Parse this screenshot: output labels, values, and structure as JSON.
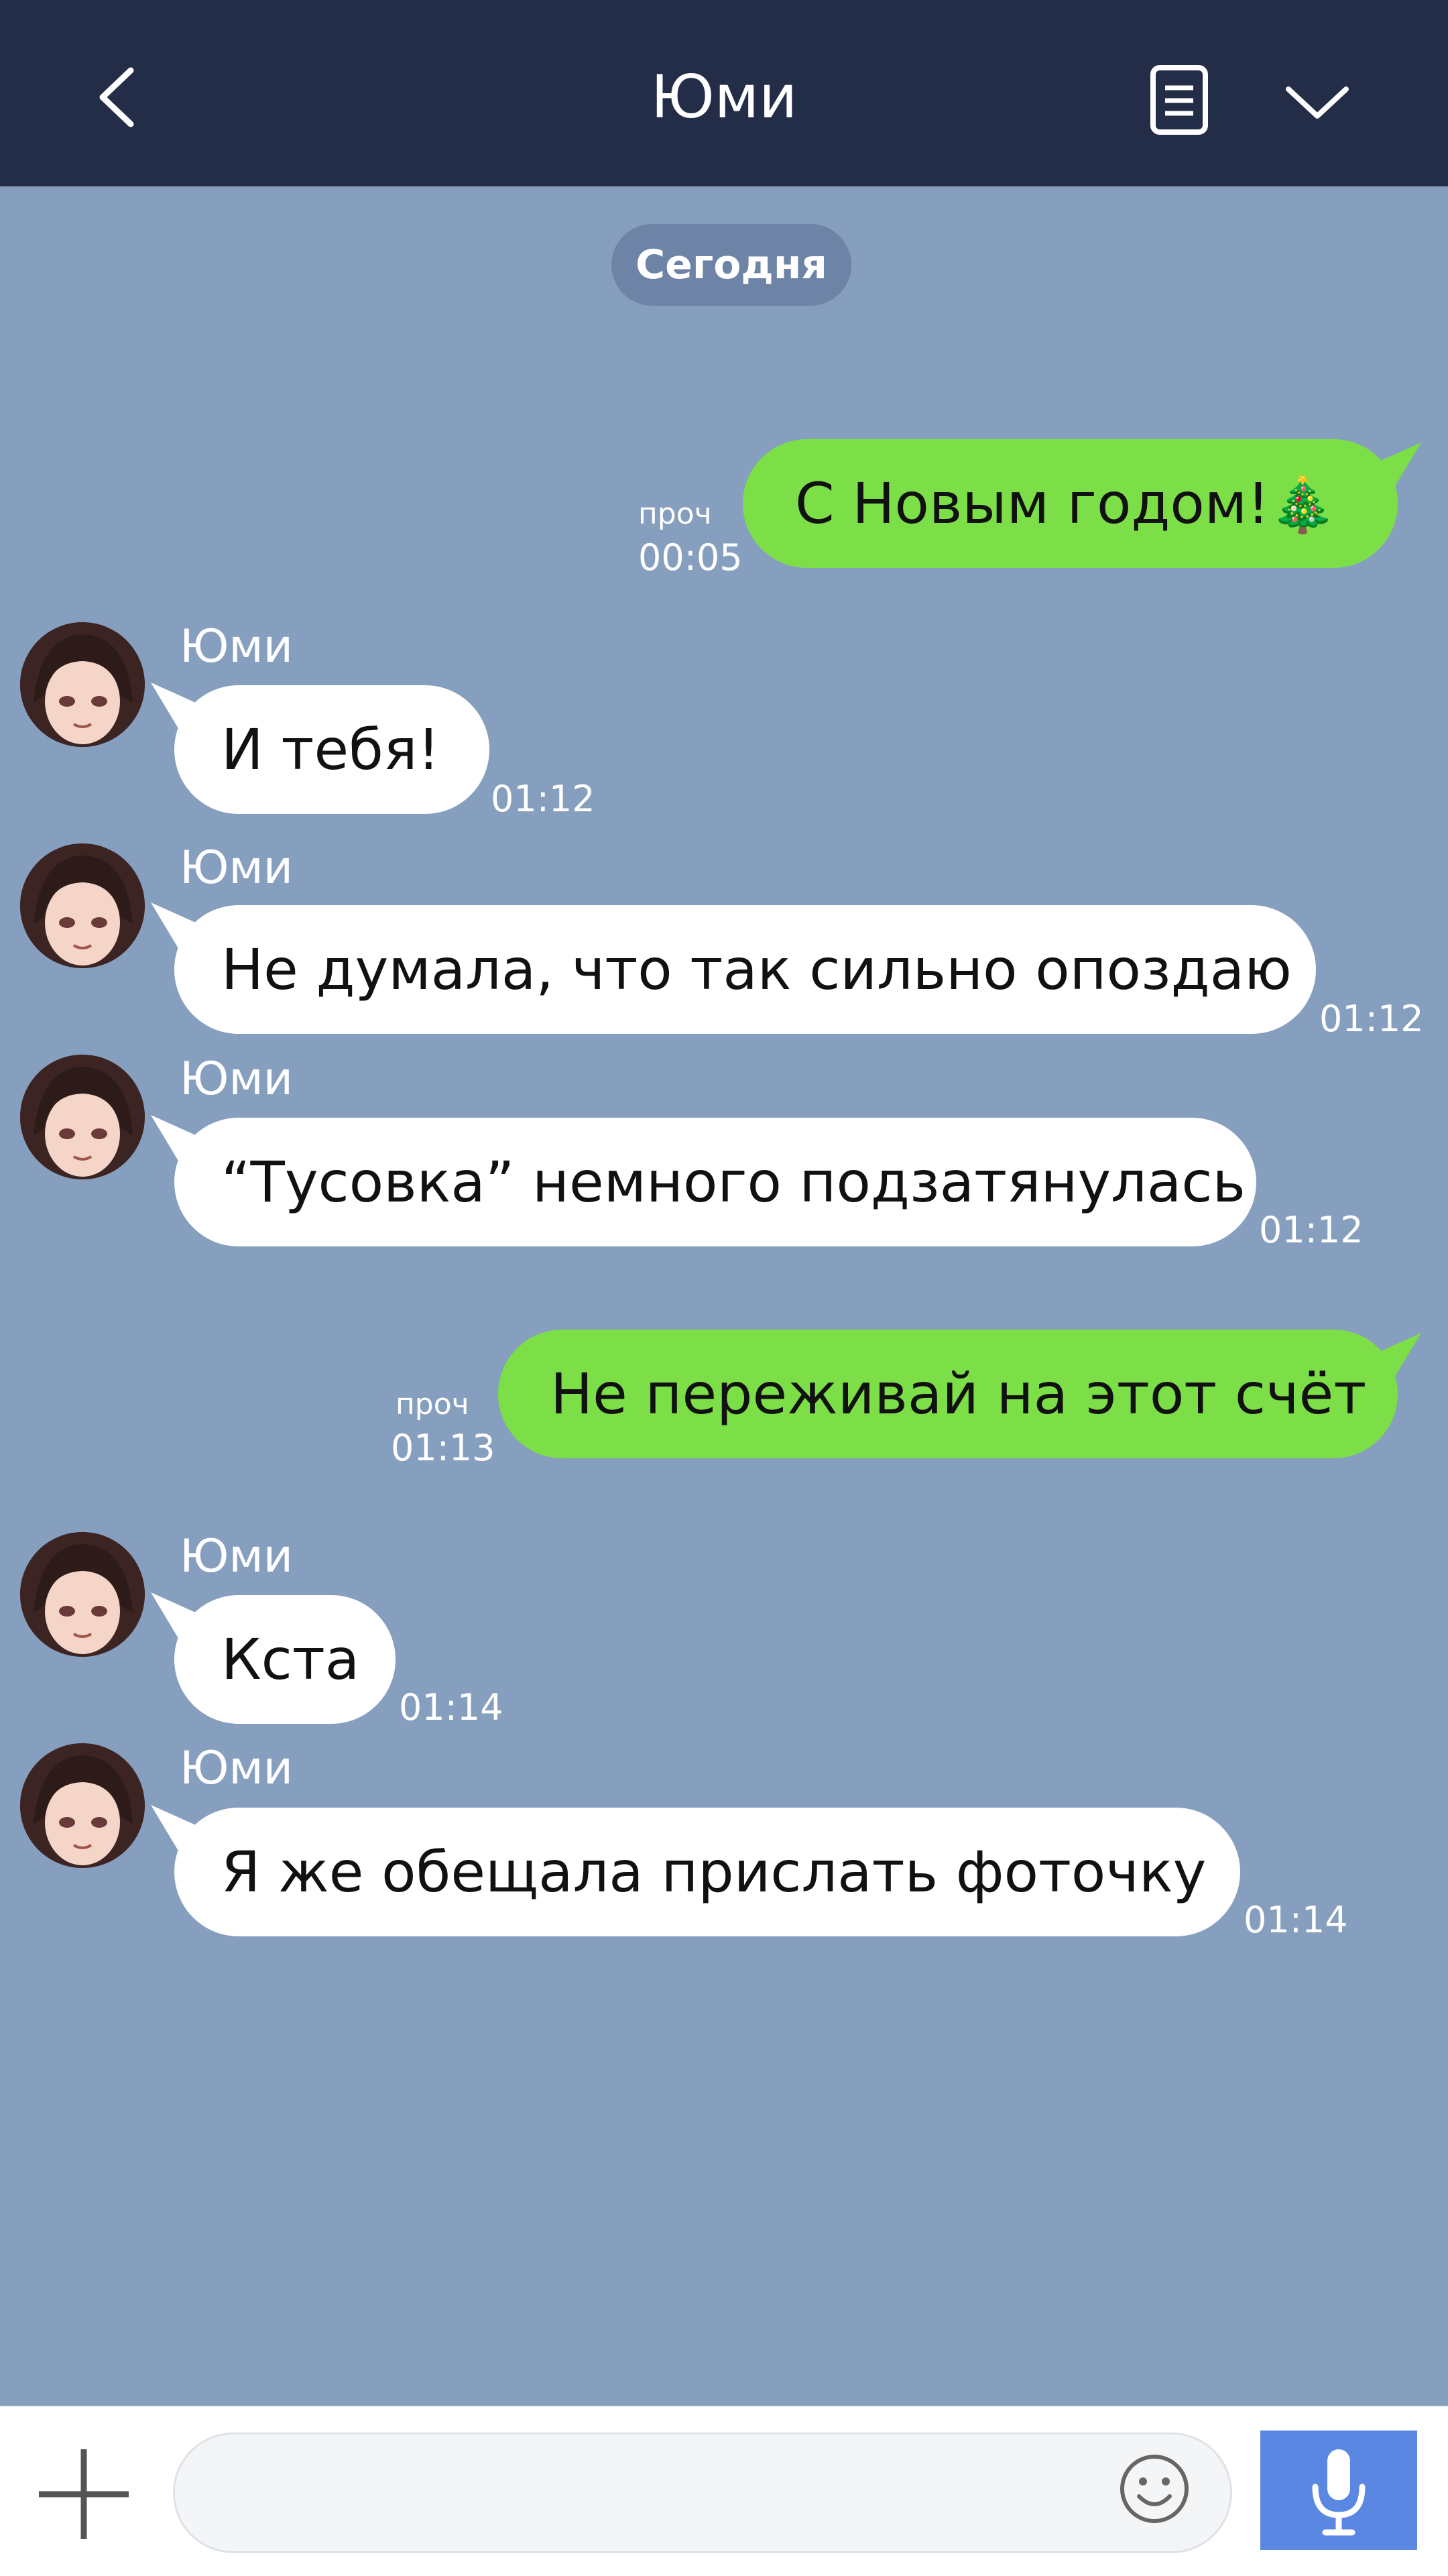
{
  "header": {
    "title": "Юми",
    "back_icon": "chevron-left-icon",
    "notes_icon": "notes-icon",
    "menu_icon": "chevron-down-icon"
  },
  "date_separator": "Сегодня",
  "messages": [
    {
      "direction": "out",
      "text": "С Новым годом!",
      "emoji": "🎄",
      "read": "проч",
      "time": "00:05"
    },
    {
      "direction": "in",
      "sender": "Юми",
      "text": "И тебя!",
      "time": "01:12"
    },
    {
      "direction": "in",
      "sender": "Юми",
      "text": "Не думала, что так сильно опоздаю",
      "time": "01:12"
    },
    {
      "direction": "in",
      "sender": "Юми",
      "text": "“Тусовка” немного подзатянулась",
      "time": "01:12"
    },
    {
      "direction": "out",
      "text": "Не переживай на этот счёт",
      "read": "проч",
      "time": "01:13"
    },
    {
      "direction": "in",
      "sender": "Юми",
      "text": "Кста",
      "time": "01:14"
    },
    {
      "direction": "in",
      "sender": "Юми",
      "text": "Я же обещала прислать фоточку",
      "time": "01:14"
    }
  ],
  "input": {
    "value": "",
    "placeholder": ""
  },
  "colors": {
    "header_bg": "#232d47",
    "chat_bg": "#869fbf",
    "out_bubble": "#7ddf47",
    "in_bubble": "#ffffff",
    "send_button": "#5a87e2"
  }
}
